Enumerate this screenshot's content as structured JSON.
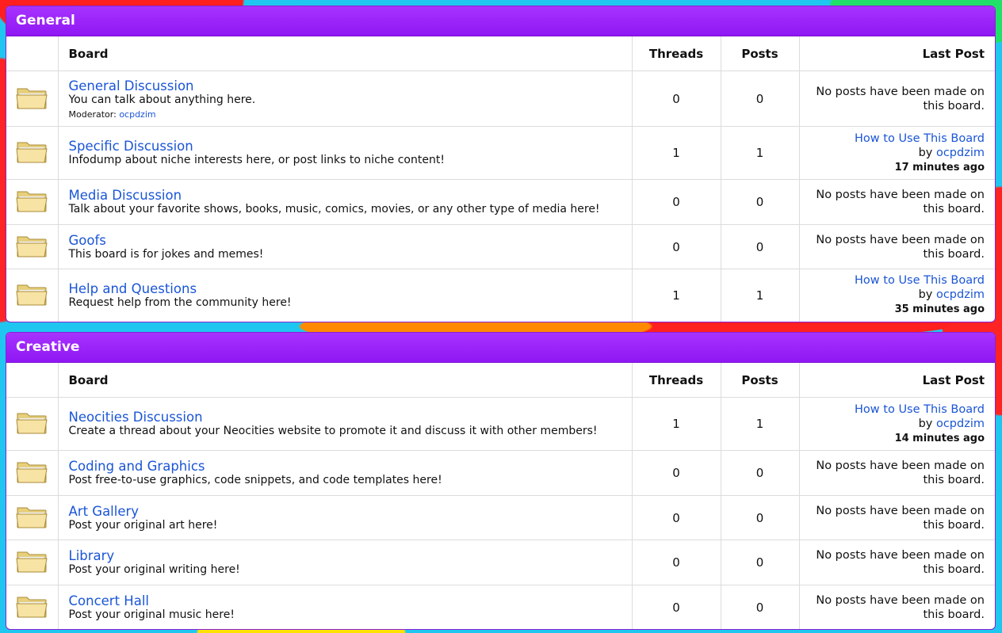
{
  "columns": {
    "board": "Board",
    "threads": "Threads",
    "posts": "Posts",
    "last_post": "Last Post"
  },
  "no_posts_text": "No posts have been made on this board.",
  "by_text": "by",
  "categories": [
    {
      "name": "General",
      "boards": [
        {
          "title": "General Discussion",
          "description": "You can talk about anything here.",
          "moderator_label": "Moderator:",
          "moderator": "ocpdzim",
          "threads": "0",
          "posts": "0",
          "last_post": null
        },
        {
          "title": "Specific Discussion",
          "description": "Infodump about niche interests here, or post links to niche content!",
          "threads": "1",
          "posts": "1",
          "last_post": {
            "title": "How to Use This Board",
            "author": "ocpdzim",
            "time": "17 minutes ago"
          }
        },
        {
          "title": "Media Discussion",
          "description": "Talk about your favorite shows, books, music, comics, movies, or any other type of media here!",
          "threads": "0",
          "posts": "0",
          "last_post": null
        },
        {
          "title": "Goofs",
          "description": "This board is for jokes and memes!",
          "threads": "0",
          "posts": "0",
          "last_post": null
        },
        {
          "title": "Help and Questions",
          "description": "Request help from the community here!",
          "threads": "1",
          "posts": "1",
          "last_post": {
            "title": "How to Use This Board",
            "author": "ocpdzim",
            "time": "35 minutes ago"
          }
        }
      ]
    },
    {
      "name": "Creative",
      "boards": [
        {
          "title": "Neocities Discussion",
          "description": "Create a thread about your Neocities website to promote it and discuss it with other members!",
          "threads": "1",
          "posts": "1",
          "last_post": {
            "title": "How to Use This Board",
            "author": "ocpdzim",
            "time": "14 minutes ago"
          }
        },
        {
          "title": "Coding and Graphics",
          "description": "Post free-to-use graphics, code snippets, and code templates here!",
          "threads": "0",
          "posts": "0",
          "last_post": null
        },
        {
          "title": "Art Gallery",
          "description": "Post your original art here!",
          "threads": "0",
          "posts": "0",
          "last_post": null
        },
        {
          "title": "Library",
          "description": "Post your original writing here!",
          "threads": "0",
          "posts": "0",
          "last_post": null
        },
        {
          "title": "Concert Hall",
          "description": "Post your original music here!",
          "threads": "0",
          "posts": "0",
          "last_post": null
        }
      ]
    }
  ]
}
